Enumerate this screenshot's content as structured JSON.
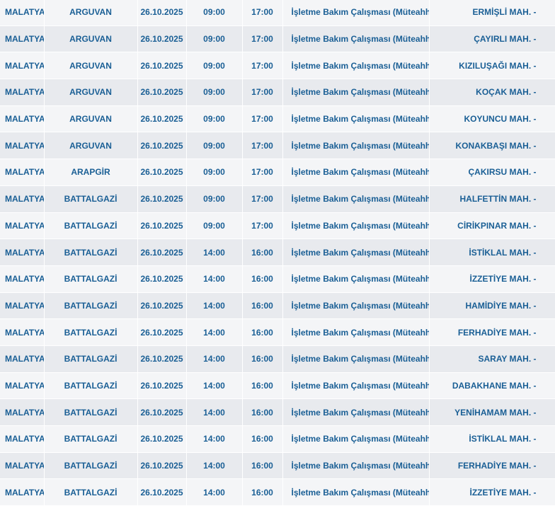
{
  "table": {
    "rows": [
      {
        "il": "MALATYA",
        "ilce": "ARGUVAN",
        "tarih": "26.10.2025",
        "baslangic": "09:00",
        "bitis": "17:00",
        "aciklama": "İşletme Bakım Çalışması (Müteahhit)",
        "mahalle": "ERMİŞLİ MAH. -"
      },
      {
        "il": "MALATYA",
        "ilce": "ARGUVAN",
        "tarih": "26.10.2025",
        "baslangic": "09:00",
        "bitis": "17:00",
        "aciklama": "İşletme Bakım Çalışması (Müteahhit)",
        "mahalle": "ÇAYIRLI MAH. -"
      },
      {
        "il": "MALATYA",
        "ilce": "ARGUVAN",
        "tarih": "26.10.2025",
        "baslangic": "09:00",
        "bitis": "17:00",
        "aciklama": "İşletme Bakım Çalışması (Müteahhit)",
        "mahalle": "KIZILUŞAĞI MAH. -"
      },
      {
        "il": "MALATYA",
        "ilce": "ARGUVAN",
        "tarih": "26.10.2025",
        "baslangic": "09:00",
        "bitis": "17:00",
        "aciklama": "İşletme Bakım Çalışması (Müteahhit)",
        "mahalle": "KOÇAK MAH. -"
      },
      {
        "il": "MALATYA",
        "ilce": "ARGUVAN",
        "tarih": "26.10.2025",
        "baslangic": "09:00",
        "bitis": "17:00",
        "aciklama": "İşletme Bakım Çalışması (Müteahhit)",
        "mahalle": "KOYUNCU MAH. -"
      },
      {
        "il": "MALATYA",
        "ilce": "ARGUVAN",
        "tarih": "26.10.2025",
        "baslangic": "09:00",
        "bitis": "17:00",
        "aciklama": "İşletme Bakım Çalışması (Müteahhit)",
        "mahalle": "KONAKBAŞI MAH. -"
      },
      {
        "il": "MALATYA",
        "ilce": "ARAPGİR",
        "tarih": "26.10.2025",
        "baslangic": "09:00",
        "bitis": "17:00",
        "aciklama": "İşletme Bakım Çalışması (Müteahhit)",
        "mahalle": "ÇAKIRSU MAH. -"
      },
      {
        "il": "MALATYA",
        "ilce": "BATTALGAZİ",
        "tarih": "26.10.2025",
        "baslangic": "09:00",
        "bitis": "17:00",
        "aciklama": "İşletme Bakım Çalışması (Müteahhit)",
        "mahalle": "HALFETTİN MAH. -"
      },
      {
        "il": "MALATYA",
        "ilce": "BATTALGAZİ",
        "tarih": "26.10.2025",
        "baslangic": "09:00",
        "bitis": "17:00",
        "aciklama": "İşletme Bakım Çalışması (Müteahhit)",
        "mahalle": "CİRİKPINAR MAH. -"
      },
      {
        "il": "MALATYA",
        "ilce": "BATTALGAZİ",
        "tarih": "26.10.2025",
        "baslangic": "14:00",
        "bitis": "16:00",
        "aciklama": "İşletme Bakım Çalışması (Müteahhit)",
        "mahalle": "İSTİKLAL MAH. -"
      },
      {
        "il": "MALATYA",
        "ilce": "BATTALGAZİ",
        "tarih": "26.10.2025",
        "baslangic": "14:00",
        "bitis": "16:00",
        "aciklama": "İşletme Bakım Çalışması (Müteahhit)",
        "mahalle": "İZZETİYE MAH. -"
      },
      {
        "il": "MALATYA",
        "ilce": "BATTALGAZİ",
        "tarih": "26.10.2025",
        "baslangic": "14:00",
        "bitis": "16:00",
        "aciklama": "İşletme Bakım Çalışması (Müteahhit)",
        "mahalle": "HAMİDİYE MAH. -"
      },
      {
        "il": "MALATYA",
        "ilce": "BATTALGAZİ",
        "tarih": "26.10.2025",
        "baslangic": "14:00",
        "bitis": "16:00",
        "aciklama": "İşletme Bakım Çalışması (Müteahhit)",
        "mahalle": "FERHADİYE MAH. -"
      },
      {
        "il": "MALATYA",
        "ilce": "BATTALGAZİ",
        "tarih": "26.10.2025",
        "baslangic": "14:00",
        "bitis": "16:00",
        "aciklama": "İşletme Bakım Çalışması (Müteahhit)",
        "mahalle": "SARAY MAH. -"
      },
      {
        "il": "MALATYA",
        "ilce": "BATTALGAZİ",
        "tarih": "26.10.2025",
        "baslangic": "14:00",
        "bitis": "16:00",
        "aciklama": "İşletme Bakım Çalışması (Müteahhit)",
        "mahalle": "DABAKHANE MAH. -"
      },
      {
        "il": "MALATYA",
        "ilce": "BATTALGAZİ",
        "tarih": "26.10.2025",
        "baslangic": "14:00",
        "bitis": "16:00",
        "aciklama": "İşletme Bakım Çalışması (Müteahhit)",
        "mahalle": "YENİHAMAM MAH. -"
      },
      {
        "il": "MALATYA",
        "ilce": "BATTALGAZİ",
        "tarih": "26.10.2025",
        "baslangic": "14:00",
        "bitis": "16:00",
        "aciklama": "İşletme Bakım Çalışması (Müteahhit)",
        "mahalle": "İSTİKLAL MAH. -"
      },
      {
        "il": "MALATYA",
        "ilce": "BATTALGAZİ",
        "tarih": "26.10.2025",
        "baslangic": "14:00",
        "bitis": "16:00",
        "aciklama": "İşletme Bakım Çalışması (Müteahhit)",
        "mahalle": "FERHADİYE MAH. -"
      },
      {
        "il": "MALATYA",
        "ilce": "BATTALGAZİ",
        "tarih": "26.10.2025",
        "baslangic": "14:00",
        "bitis": "16:00",
        "aciklama": "İşletme Bakım Çalışması (Müteahhit)",
        "mahalle": "İZZETİYE MAH. -"
      }
    ]
  },
  "colors": {
    "text": "#1a5f95",
    "row_odd": "#f4f5f7",
    "row_even": "#e8eaee"
  }
}
